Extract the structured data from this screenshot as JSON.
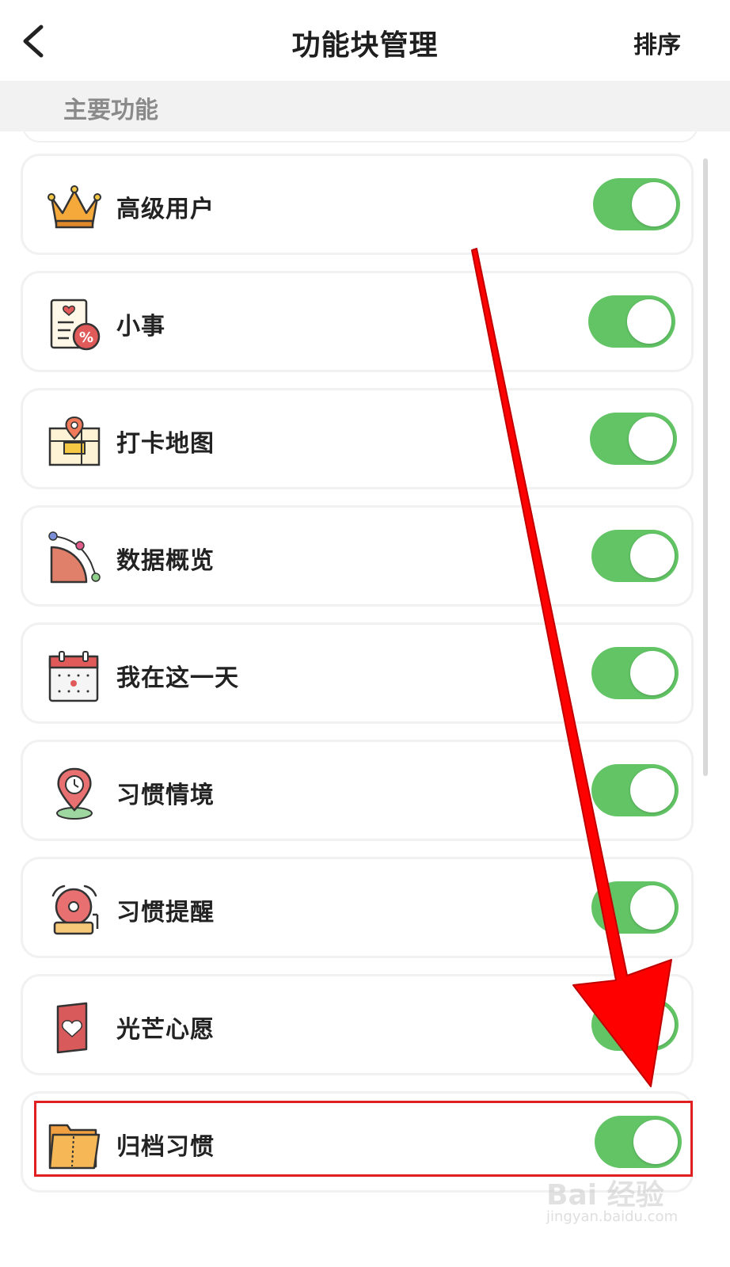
{
  "header": {
    "title": "功能块管理",
    "sort_label": "排序"
  },
  "section": {
    "title": "主要功能"
  },
  "items": [
    {
      "label": "高级用户",
      "icon": "crown-icon",
      "enabled": true
    },
    {
      "label": "小事",
      "icon": "checklist-percent-icon",
      "enabled": true
    },
    {
      "label": "打卡地图",
      "icon": "map-pin-icon",
      "enabled": true
    },
    {
      "label": "数据概览",
      "icon": "pie-chart-icon",
      "enabled": true
    },
    {
      "label": "我在这一天",
      "icon": "calendar-icon",
      "enabled": true
    },
    {
      "label": "习惯情境",
      "icon": "location-clock-icon",
      "enabled": true
    },
    {
      "label": "习惯提醒",
      "icon": "alarm-bell-icon",
      "enabled": true
    },
    {
      "label": "光芒心愿",
      "icon": "heart-card-icon",
      "enabled": true
    },
    {
      "label": "归档习惯",
      "icon": "archive-folder-icon",
      "enabled": true
    }
  ],
  "colors": {
    "toggle_on": "#62c465",
    "highlight": "#e02020",
    "arrow": "#ff0000"
  },
  "watermark": {
    "brand": "Bai 经验",
    "url": "jingyan.baidu.com"
  }
}
